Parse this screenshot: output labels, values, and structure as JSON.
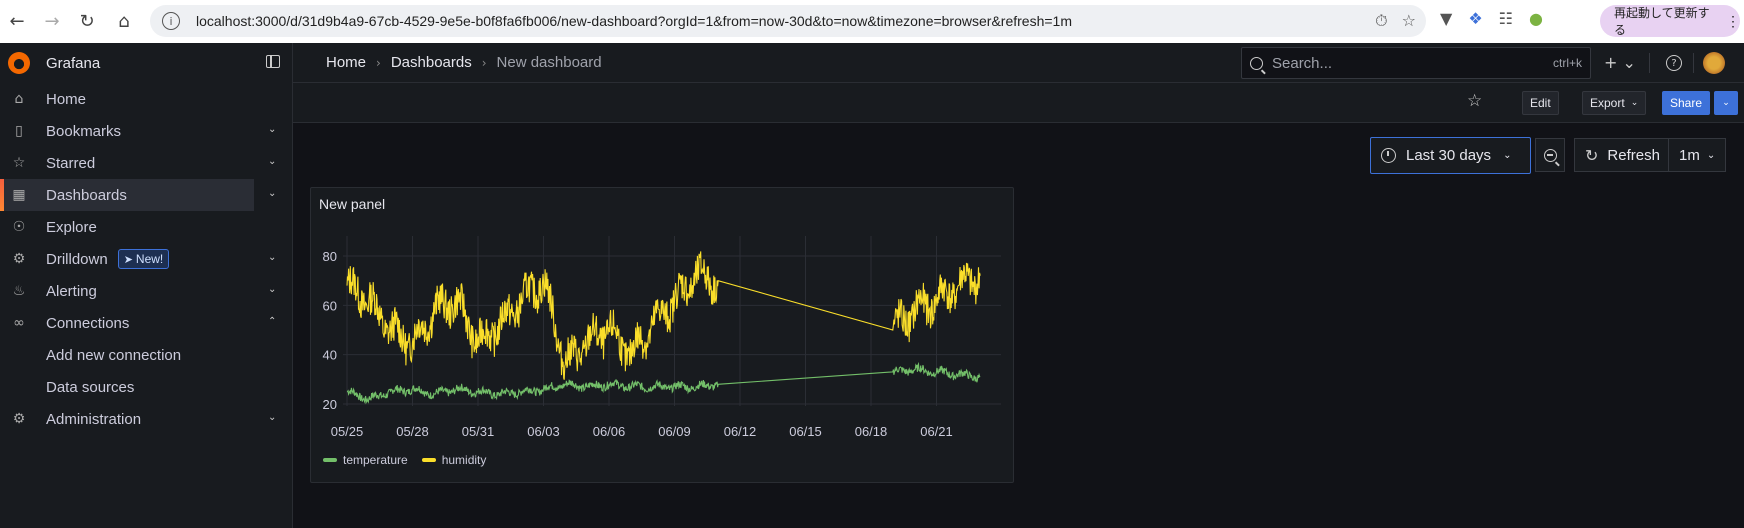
{
  "browser": {
    "url": "localhost:3000/d/31d9b4a9-67cb-4529-9e5e-b0f8fa6fb006/new-dashboard?orgId=1&from=now-30d&to=now&timezone=browser&refresh=1m",
    "restart_label": "再起動して更新する"
  },
  "sidebar": {
    "brand": "Grafana",
    "items": [
      {
        "label": "Home",
        "icon": "home-icon"
      },
      {
        "label": "Bookmarks",
        "icon": "bookmark-icon"
      },
      {
        "label": "Starred",
        "icon": "star-icon"
      },
      {
        "label": "Dashboards",
        "icon": "grid-icon"
      },
      {
        "label": "Explore",
        "icon": "compass-icon"
      },
      {
        "label": "Drilldown",
        "icon": "drilldown-icon",
        "badge": "New!"
      },
      {
        "label": "Alerting",
        "icon": "bell-icon"
      },
      {
        "label": "Connections",
        "icon": "link-icon"
      },
      {
        "label": "Add new connection"
      },
      {
        "label": "Data sources"
      },
      {
        "label": "Administration",
        "icon": "gear-icon"
      }
    ]
  },
  "topbar": {
    "breadcrumbs": [
      "Home",
      "Dashboards",
      "New dashboard"
    ],
    "search_placeholder": "Search...",
    "search_shortcut": "ctrl+k"
  },
  "actions": {
    "edit": "Edit",
    "export": "Export",
    "share": "Share"
  },
  "time": {
    "range": "Last 30 days",
    "refresh": "Refresh",
    "interval": "1m"
  },
  "panel": {
    "title": "New panel"
  },
  "colors": {
    "temperature": "#73bf69",
    "humidity": "#fade2a",
    "accent": "#3d71d9"
  },
  "chart_data": {
    "type": "line",
    "title": "New panel",
    "x_tick_labels": [
      "05/25",
      "05/28",
      "05/31",
      "06/03",
      "06/06",
      "06/09",
      "06/12",
      "06/15",
      "06/18",
      "06/21"
    ],
    "y_ticks": [
      20,
      40,
      60,
      80
    ],
    "ylim": [
      15,
      85
    ],
    "xlim": [
      "05/25",
      "06/23"
    ],
    "gap": [
      "06/11",
      "06/19"
    ],
    "series": [
      {
        "name": "temperature",
        "points": [
          [
            "05/25",
            25
          ],
          [
            "05/26",
            22
          ],
          [
            "05/27",
            25
          ],
          [
            "05/28",
            26
          ],
          [
            "05/29",
            24
          ],
          [
            "05/30",
            26
          ],
          [
            "05/31",
            25
          ],
          [
            "06/01",
            24
          ],
          [
            "06/02",
            25
          ],
          [
            "06/03",
            26
          ],
          [
            "06/04",
            28
          ],
          [
            "06/05",
            27
          ],
          [
            "06/06",
            28
          ],
          [
            "06/07",
            27
          ],
          [
            "06/08",
            27
          ],
          [
            "06/09",
            27
          ],
          [
            "06/10",
            27
          ],
          [
            "06/11",
            28
          ],
          [
            "06/19",
            33
          ],
          [
            "06/20",
            34
          ],
          [
            "06/21",
            33
          ],
          [
            "06/22",
            32
          ],
          [
            "06/23",
            31
          ]
        ]
      },
      {
        "name": "humidity",
        "points": [
          [
            "05/25",
            68
          ],
          [
            "05/26",
            62
          ],
          [
            "05/27",
            50
          ],
          [
            "05/28",
            45
          ],
          [
            "05/29",
            58
          ],
          [
            "05/30",
            62
          ],
          [
            "05/31",
            45
          ],
          [
            "06/01",
            52
          ],
          [
            "06/02",
            62
          ],
          [
            "06/03",
            70
          ],
          [
            "06/04",
            36
          ],
          [
            "06/05",
            45
          ],
          [
            "06/06",
            50
          ],
          [
            "06/07",
            40
          ],
          [
            "06/08",
            52
          ],
          [
            "06/09",
            62
          ],
          [
            "06/10",
            72
          ],
          [
            "06/11",
            70
          ],
          [
            "06/19",
            50
          ],
          [
            "06/20",
            58
          ],
          [
            "06/21",
            62
          ],
          [
            "06/22",
            68
          ],
          [
            "06/23",
            72
          ]
        ]
      }
    ],
    "legend": [
      "temperature",
      "humidity"
    ],
    "legend_position": "bottom-left",
    "grid": true
  }
}
